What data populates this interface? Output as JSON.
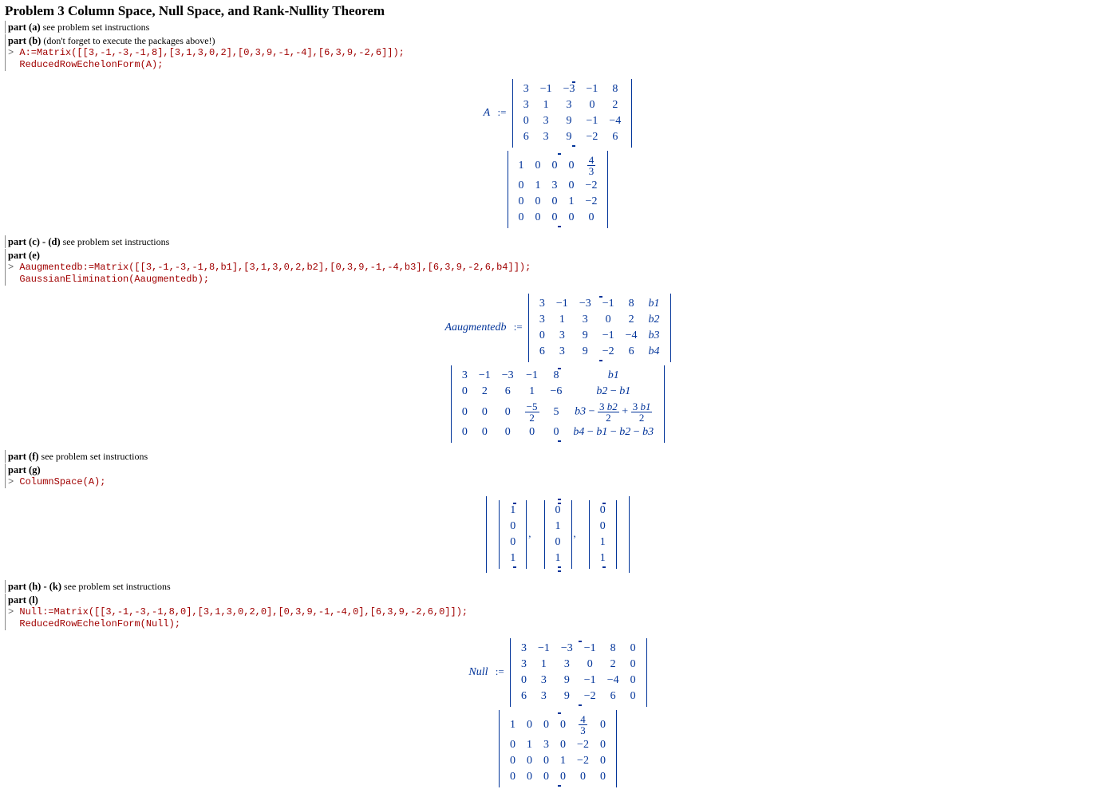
{
  "title": "Problem 3 Column Space, Null Space, and Rank-Nullity Theorem",
  "parts": {
    "a": {
      "label": "part (a)",
      "note": " see problem set instructions"
    },
    "b": {
      "label": "part (b)",
      "note": " (don't forget to execute the packages above!)",
      "code": "A:=Matrix([[3,-1,-3,-1,8],[3,1,3,0,2],[0,3,9,-1,-4],[6,3,9,-2,6]]);\n  ReducedRowEchelonForm(A);"
    },
    "cd": {
      "label": "part (c) - (d)",
      "note": "  see problem set instructions"
    },
    "e": {
      "label": "part (e)",
      "note": "",
      "code": "Aaugmentedb:=Matrix([[3,-1,-3,-1,8,b1],[3,1,3,0,2,b2],[0,3,9,-1,-4,b3],[6,3,9,-2,6,b4]]);\n  GaussianElimination(Aaugmentedb);"
    },
    "f": {
      "label": "part (f)",
      "note": " see problem set instructions"
    },
    "g": {
      "label": "part (g)",
      "note": "",
      "code": "ColumnSpace(A);"
    },
    "hk": {
      "label": "part (h) - (k)",
      "note": "  see problem set instructions"
    },
    "l": {
      "label": "part (l)",
      "note": "",
      "code": "Null:=Matrix([[3,-1,-3,-1,8,0],[3,1,3,0,2,0],[0,3,9,-1,-4,0],[6,3,9,-2,6,0]]);\n  ReducedRowEchelonForm(Null);"
    }
  },
  "outputs": {
    "A_label": "A",
    "A_matrix": [
      [
        "3",
        "−1",
        "−3",
        "−1",
        "8"
      ],
      [
        "3",
        "1",
        "3",
        "0",
        "2"
      ],
      [
        "0",
        "3",
        "9",
        "−1",
        "−4"
      ],
      [
        "6",
        "3",
        "9",
        "−2",
        "6"
      ]
    ],
    "A_rref": [
      [
        "1",
        "0",
        "0",
        "0",
        "4/3"
      ],
      [
        "0",
        "1",
        "3",
        "0",
        "−2"
      ],
      [
        "0",
        "0",
        "0",
        "1",
        "−2"
      ],
      [
        "0",
        "0",
        "0",
        "0",
        "0"
      ]
    ],
    "Ab_label": "Aaugmentedb",
    "Ab_matrix": [
      [
        "3",
        "−1",
        "−3",
        "−1",
        "8",
        "b1"
      ],
      [
        "3",
        "1",
        "3",
        "0",
        "2",
        "b2"
      ],
      [
        "0",
        "3",
        "9",
        "−1",
        "−4",
        "b3"
      ],
      [
        "6",
        "3",
        "9",
        "−2",
        "6",
        "b4"
      ]
    ],
    "Ab_gauss": [
      [
        "3",
        "−1",
        "−3",
        "−1",
        "8",
        "b1"
      ],
      [
        "0",
        "2",
        "6",
        "1",
        "−6",
        "b2 − b1"
      ],
      [
        "0",
        "0",
        "0",
        "−5/2",
        "5",
        "b3 − (3 b2)/2 + (3 b1)/2"
      ],
      [
        "0",
        "0",
        "0",
        "0",
        "0",
        "b4 − b1 − b2 − b3"
      ]
    ],
    "colspace": [
      [
        "1",
        "0",
        "0",
        "1"
      ],
      [
        "0",
        "1",
        "0",
        "1"
      ],
      [
        "0",
        "0",
        "1",
        "1"
      ]
    ],
    "Null_label": "Null",
    "Null_matrix": [
      [
        "3",
        "−1",
        "−3",
        "−1",
        "8",
        "0"
      ],
      [
        "3",
        "1",
        "3",
        "0",
        "2",
        "0"
      ],
      [
        "0",
        "3",
        "9",
        "−1",
        "−4",
        "0"
      ],
      [
        "6",
        "3",
        "9",
        "−2",
        "6",
        "0"
      ]
    ],
    "Null_rref": [
      [
        "1",
        "0",
        "0",
        "0",
        "4/3",
        "0"
      ],
      [
        "0",
        "1",
        "3",
        "0",
        "−2",
        "0"
      ],
      [
        "0",
        "0",
        "0",
        "1",
        "−2",
        "0"
      ],
      [
        "0",
        "0",
        "0",
        "0",
        "0",
        "0"
      ]
    ]
  },
  "assign_sym": ":="
}
